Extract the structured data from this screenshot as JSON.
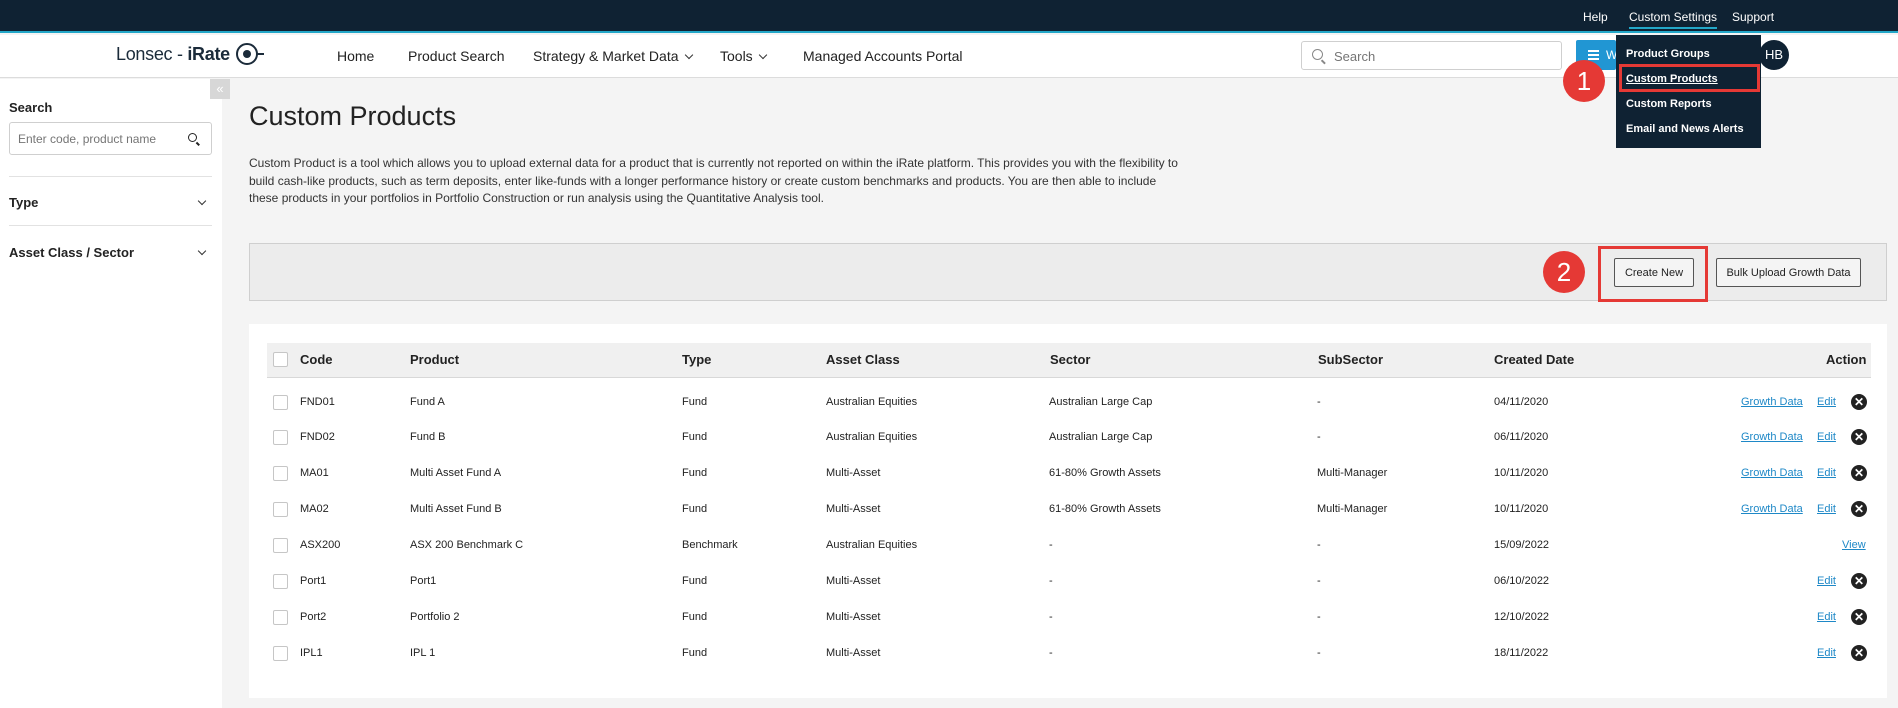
{
  "topbar": {
    "help": "Help",
    "custom_settings": "Custom Settings",
    "support": "Support"
  },
  "brand": {
    "name_a": "Lonsec",
    "sep": " - ",
    "name_b": "iRate"
  },
  "nav": {
    "home": "Home",
    "product_search": "Product Search",
    "strategy": "Strategy & Market Data",
    "tools": "Tools",
    "managed": "Managed Accounts Portal"
  },
  "header_search": {
    "placeholder": "Search"
  },
  "header": {
    "blue_btn_letter": "W",
    "avatar": "HB"
  },
  "dropdown": {
    "items": [
      "Product Groups",
      "Custom Products",
      "Custom Reports",
      "Email and News Alerts"
    ],
    "selected": "Custom Products"
  },
  "annotations": {
    "step1": "1",
    "step2": "2"
  },
  "sidebar": {
    "collapse_glyph": "«",
    "search_label": "Search",
    "search_placeholder": "Enter code, product name",
    "filters": [
      "Type",
      "Asset Class / Sector"
    ]
  },
  "page": {
    "title": "Custom Products",
    "description": "Custom Product is a tool which allows you to upload external data for a product that is currently not reported on within the iRate platform. This provides you with the flexibility to build cash-like products, such as term deposits, enter like-funds with a longer performance history or create custom benchmarks and products. You are then able to include these products in your portfolios in Portfolio Construction or run analysis using the Quantitative Analysis tool."
  },
  "actions": {
    "create_new": "Create New",
    "bulk_upload": "Bulk Upload Growth Data"
  },
  "table": {
    "headers": {
      "code": "Code",
      "product": "Product",
      "type": "Type",
      "asset_class": "Asset Class",
      "sector": "Sector",
      "subsector": "SubSector",
      "created": "Created Date",
      "action": "Action"
    },
    "action_labels": {
      "growth": "Growth Data",
      "edit": "Edit",
      "view": "View",
      "delete": "✕"
    },
    "rows": [
      {
        "code": "FND01",
        "product": "Fund A",
        "type": "Fund",
        "asset_class": "Australian Equities",
        "sector": "Australian Large Cap",
        "subsector": "-",
        "created": "04/11/2020"
      },
      {
        "code": "FND02",
        "product": "Fund B",
        "type": "Fund",
        "asset_class": "Australian Equities",
        "sector": "Australian Large Cap",
        "subsector": "-",
        "created": "06/11/2020"
      },
      {
        "code": "MA01",
        "product": "Multi Asset Fund A",
        "type": "Fund",
        "asset_class": "Multi-Asset",
        "sector": "61-80% Growth Assets",
        "subsector": "Multi-Manager",
        "created": "10/11/2020"
      },
      {
        "code": "MA02",
        "product": "Multi Asset Fund B",
        "type": "Fund",
        "asset_class": "Multi-Asset",
        "sector": "61-80% Growth Assets",
        "subsector": "Multi-Manager",
        "created": "10/11/2020"
      },
      {
        "code": "ASX200",
        "product": "ASX 200 Benchmark C",
        "type": "Benchmark",
        "asset_class": "Australian Equities",
        "sector": "-",
        "subsector": "-",
        "created": "15/09/2022"
      },
      {
        "code": "Port1",
        "product": "Port1",
        "type": "Fund",
        "asset_class": "Multi-Asset",
        "sector": "-",
        "subsector": "-",
        "created": "06/10/2022"
      },
      {
        "code": "Port2",
        "product": "Portfolio 2",
        "type": "Fund",
        "asset_class": "Multi-Asset",
        "sector": "-",
        "subsector": "-",
        "created": "12/10/2022"
      },
      {
        "code": "IPL1",
        "product": "IPL 1",
        "type": "Fund",
        "asset_class": "Multi-Asset",
        "sector": "-",
        "subsector": "-",
        "created": "18/11/2022"
      }
    ]
  }
}
